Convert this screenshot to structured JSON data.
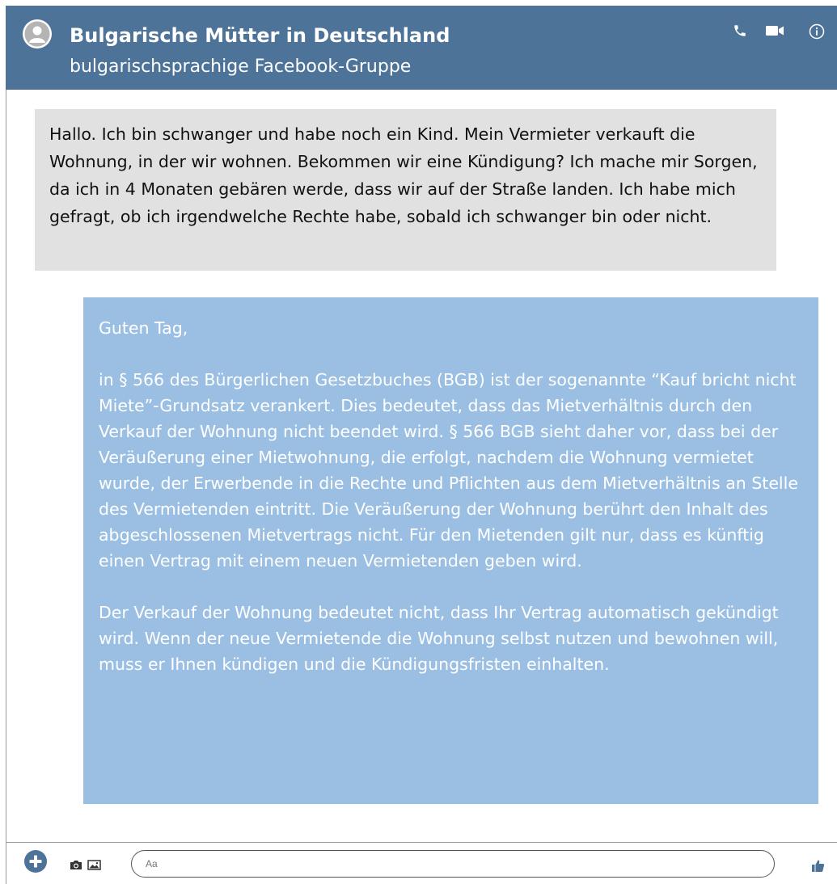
{
  "header": {
    "title": "Bulgarische Mütter in Deutschland",
    "subtitle": "bulgarischsprachige Facebook-Gruppe",
    "icons": [
      "phone-icon",
      "video-camera-icon",
      "info-icon"
    ],
    "color": "#4d7398"
  },
  "messages": {
    "incoming": {
      "text": "Hallo. Ich bin schwanger und habe noch ein Kind. Mein Vermieter verkauft die Wohnung, in der wir wohnen. Bekommen wir eine Kündigung? Ich mache mir Sorgen, da ich in 4 Monaten gebären werde, dass wir auf der Straße landen. Ich habe mich gefragt, ob ich irgendwelche Rechte habe, sobald ich schwanger bin oder nicht.",
      "color": "#e1e1e1"
    },
    "outgoing": {
      "greeting": "Guten Tag,",
      "paragraph1": "in § 566 des Bürgerlichen Gesetzbuches (BGB) ist der sogenannte “Kauf bricht nicht Miete”-Grundsatz verankert. Dies bedeutet, dass das Mietverhältnis durch den Verkauf der Wohnung nicht beendet wird. § 566 BGB sieht daher vor, dass bei der Veräußerung einer Mietwohnung, die erfolgt, nachdem die Wohnung vermietet wurde, der Erwerbende in die Rechte und Pflichten aus dem Mietverhältnis an Stelle des Vermietenden eintritt. Die Veräußerung der Wohnung berührt den Inhalt des abgeschlossenen Mietvertrags nicht. Für den Mietenden gilt nur, dass es künftig einen Vertrag mit einem neuen Vermietenden geben wird.",
      "paragraph2": "Der Verkauf der Wohnung bedeutet nicht, dass Ihr Vertrag automatisch gekündigt wird. Wenn der neue Vermietende die Wohnung selbst nutzen und bewohnen will, muss er Ihnen kündigen und die Kündigungsfristen einhalten.",
      "color": "#9bbfe3"
    }
  },
  "composer": {
    "placeholder": "Aa",
    "icons": [
      "plus-icon",
      "camera-icon",
      "image-icon",
      "thumbs-up-icon"
    ],
    "accent": "#4d7398"
  }
}
